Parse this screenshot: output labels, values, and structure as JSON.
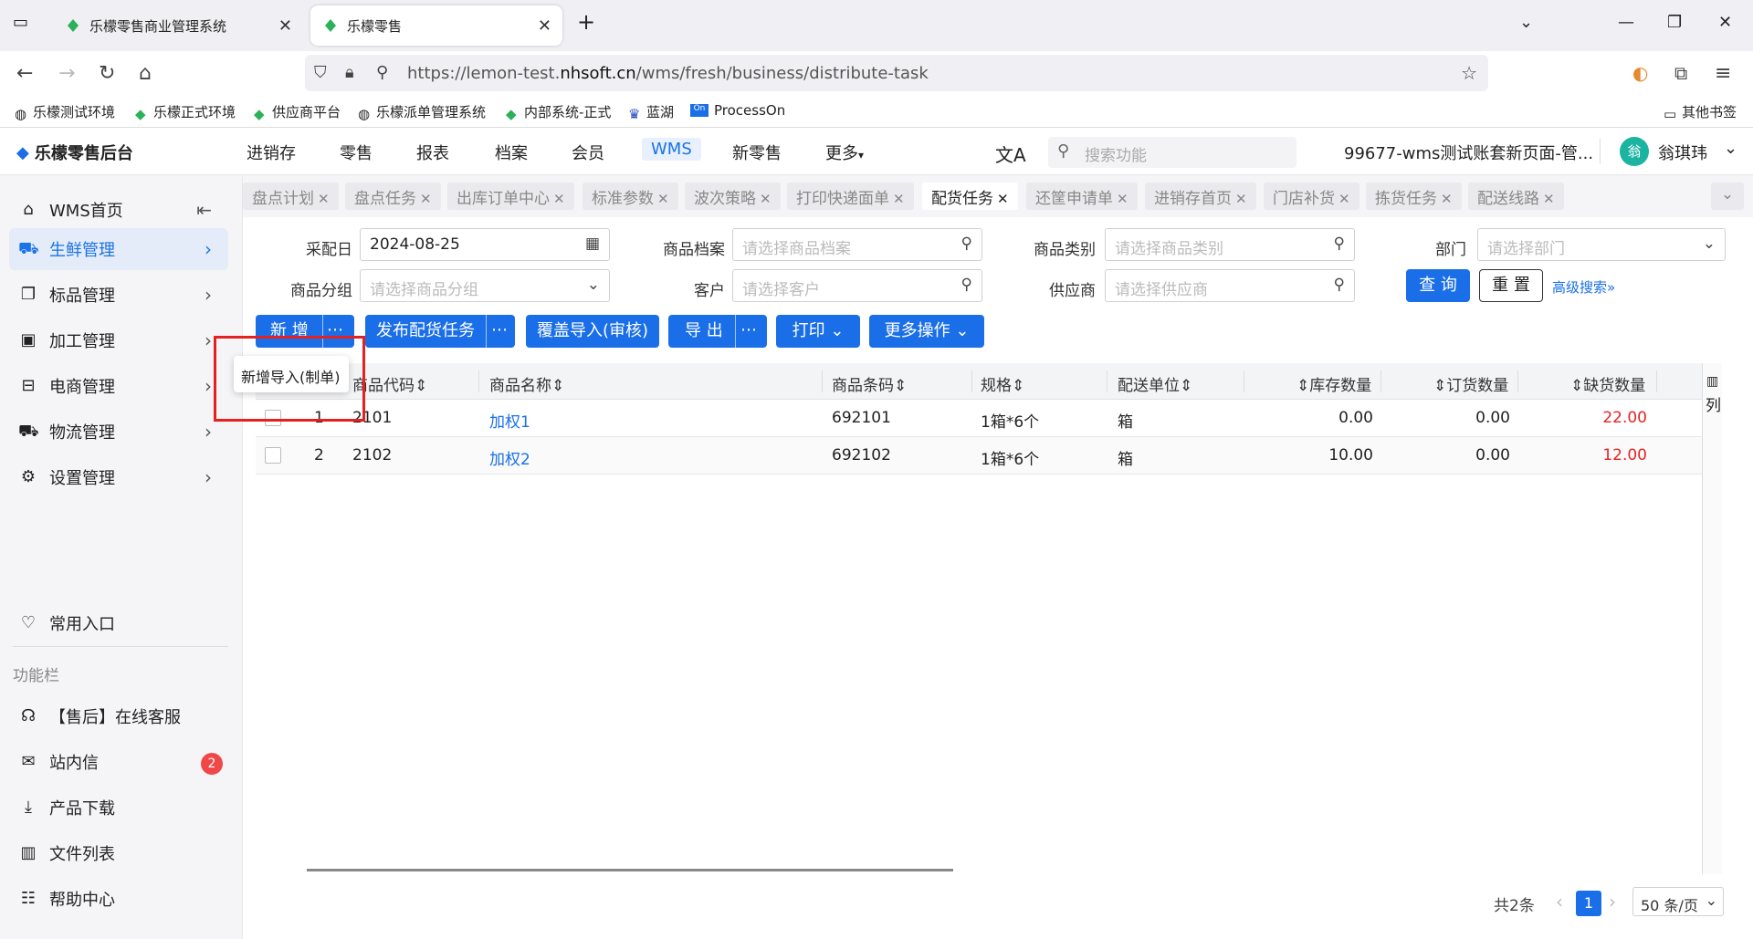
{
  "browser": {
    "tabs": [
      {
        "title": "乐檬零售商业管理系统",
        "active": false
      },
      {
        "title": "乐檬零售",
        "active": true
      }
    ],
    "url_prefix": "https://lemon-test.",
    "url_domain": "nhsoft.cn",
    "url_path": "/wms/fresh/business/distribute-task",
    "bookmarks": [
      "乐檬测试环境",
      "乐檬正式环境",
      "供应商平台",
      "乐檬派单管理系统",
      "内部系统-正式",
      "蓝湖",
      "ProcessOn"
    ],
    "other_bookmarks": "其他书签"
  },
  "app": {
    "logo_text": "乐檬零售后台",
    "top_menu": [
      "进销存",
      "零售",
      "报表",
      "档案",
      "会员",
      "WMS",
      "新零售",
      "更多"
    ],
    "active_menu": "WMS",
    "search_placeholder": "搜索功能",
    "account": "99677-wms测试账套新页面-管...",
    "avatar_char": "翁",
    "username": "翁琪玮"
  },
  "sidebar": {
    "items": [
      {
        "label": "WMS首页",
        "icon": "home-icon"
      },
      {
        "label": "生鲜管理",
        "icon": "fresh-icon",
        "active": true
      },
      {
        "label": "标品管理",
        "icon": "standard-icon"
      },
      {
        "label": "加工管理",
        "icon": "process-icon"
      },
      {
        "label": "电商管理",
        "icon": "ecommerce-icon"
      },
      {
        "label": "物流管理",
        "icon": "truck-icon"
      },
      {
        "label": "设置管理",
        "icon": "gear-icon"
      }
    ],
    "favorites_label": "常用入口",
    "section_label": "功能栏",
    "func_items": [
      "【售后】在线客服",
      "站内信",
      "产品下载",
      "文件列表",
      "帮助中心"
    ],
    "message_badge": "2"
  },
  "page_tabs": [
    {
      "label": "盘点计划"
    },
    {
      "label": "盘点任务"
    },
    {
      "label": "出库订单中心"
    },
    {
      "label": "标准参数"
    },
    {
      "label": "波次策略"
    },
    {
      "label": "打印快递面单"
    },
    {
      "label": "配货任务",
      "active": true
    },
    {
      "label": "还筐申请单"
    },
    {
      "label": "进销存首页"
    },
    {
      "label": "门店补货"
    },
    {
      "label": "拣货任务"
    },
    {
      "label": "配送线路"
    }
  ],
  "filters": {
    "date_label": "采配日",
    "date_value": "2024-08-25",
    "product_label": "商品档案",
    "product_placeholder": "请选择商品档案",
    "category_label": "商品类别",
    "category_placeholder": "请选择商品类别",
    "dept_label": "部门",
    "dept_placeholder": "请选择部门",
    "group_label": "商品分组",
    "group_placeholder": "请选择商品分组",
    "customer_label": "客户",
    "customer_placeholder": "请选择客户",
    "supplier_label": "供应商",
    "supplier_placeholder": "请选择供应商",
    "query_btn": "查 询",
    "reset_btn": "重 置",
    "advanced": "高级搜索"
  },
  "toolbar": {
    "add": "新 增",
    "publish": "发布配货任务",
    "cover_import": "覆盖导入(审核)",
    "export": "导 出",
    "print": "打印",
    "more_ops": "更多操作",
    "tooltip": "新增导入(制单)"
  },
  "table": {
    "headers": [
      "商品代码",
      "商品名称",
      "商品条码",
      "规格",
      "配送单位",
      "库存数量",
      "订货数量",
      "缺货数量"
    ],
    "rows": [
      {
        "idx": "1",
        "code": "2101",
        "name": "加权1",
        "barcode": "692101",
        "spec": "1箱*6个",
        "unit": "箱",
        "stock": "0.00",
        "order": "0.00",
        "short": "22.00"
      },
      {
        "idx": "2",
        "code": "2102",
        "name": "加权2",
        "barcode": "692102",
        "spec": "1箱*6个",
        "unit": "箱",
        "stock": "10.00",
        "order": "0.00",
        "short": "12.00"
      }
    ],
    "col_setting": "列"
  },
  "pager": {
    "total": "共2条",
    "current": "1",
    "size": "50 条/页"
  }
}
